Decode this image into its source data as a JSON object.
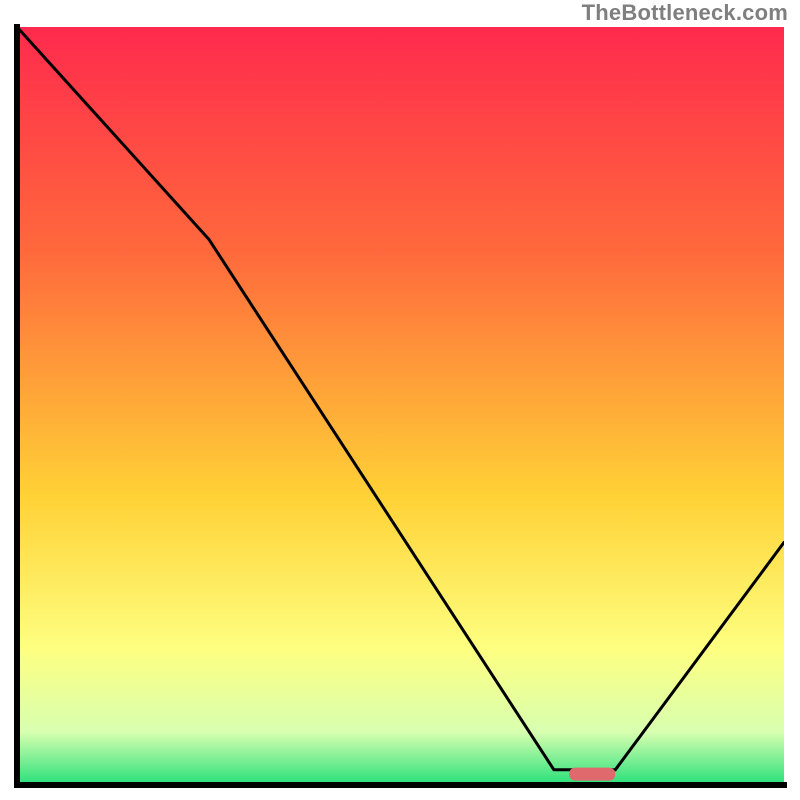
{
  "watermark": "TheBottleneck.com",
  "colors": {
    "gradient_top": "#ff2a4d",
    "gradient_mid_upper": "#ff6a3c",
    "gradient_mid": "#ffd236",
    "gradient_mid_lower": "#feff80",
    "gradient_near_bottom": "#d8ffb0",
    "gradient_bottom": "#27e07a",
    "curve": "#000000",
    "axis": "#000000",
    "marker": "#e0696d"
  },
  "chart_data": {
    "type": "line",
    "title": "",
    "xlabel": "",
    "ylabel": "",
    "xlim": [
      0,
      100
    ],
    "ylim": [
      0,
      100
    ],
    "grid": false,
    "legend": false,
    "annotations": [
      {
        "kind": "watermark",
        "text": "TheBottleneck.com",
        "position": "top-right"
      }
    ],
    "series": [
      {
        "name": "bottleneck-curve",
        "x": [
          0,
          25,
          70,
          78,
          100
        ],
        "y": [
          100,
          72,
          2,
          2,
          32
        ]
      }
    ],
    "marker": {
      "name": "optimal-range",
      "shape": "rounded-bar",
      "x_range": [
        72,
        78
      ],
      "y": 1.5,
      "color": "#e0696d"
    },
    "gradient_stops": [
      {
        "offset": 0.0,
        "color": "#ff2a4d"
      },
      {
        "offset": 0.3,
        "color": "#ff6a3c"
      },
      {
        "offset": 0.62,
        "color": "#ffd236"
      },
      {
        "offset": 0.82,
        "color": "#feff80"
      },
      {
        "offset": 0.93,
        "color": "#d8ffb0"
      },
      {
        "offset": 1.0,
        "color": "#27e07a"
      }
    ]
  }
}
